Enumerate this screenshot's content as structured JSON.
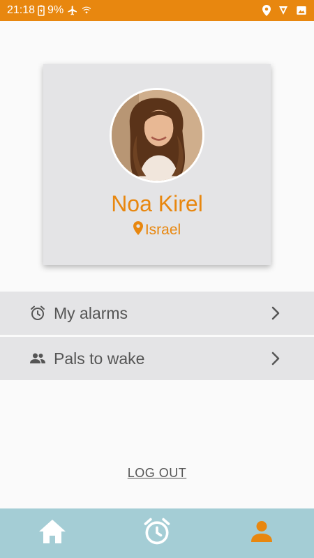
{
  "status_bar": {
    "time": "21:18",
    "battery_percent": "9%",
    "icons": [
      "battery-charging-icon",
      "airplane-icon",
      "wifi-icon",
      "location-icon",
      "navigation-icon",
      "image-icon"
    ]
  },
  "profile": {
    "name": "Noa Kirel",
    "location": "Israel",
    "location_icon": "map-pin-icon"
  },
  "menu": [
    {
      "label": "My alarms",
      "icon": "alarm-clock-icon"
    },
    {
      "label": "Pals to wake",
      "icon": "people-icon"
    }
  ],
  "logout_label": "LOG OUT",
  "bottom_nav": {
    "items": [
      {
        "icon": "home-icon",
        "active": false
      },
      {
        "icon": "alarm-clock-icon",
        "active": false
      },
      {
        "icon": "person-icon",
        "active": true
      }
    ]
  },
  "colors": {
    "accent": "#e8870f",
    "card_bg": "#e4e4e6",
    "nav_bg": "#a4cdd5",
    "nav_icon": "#ffffff",
    "text_gray": "#555555"
  }
}
